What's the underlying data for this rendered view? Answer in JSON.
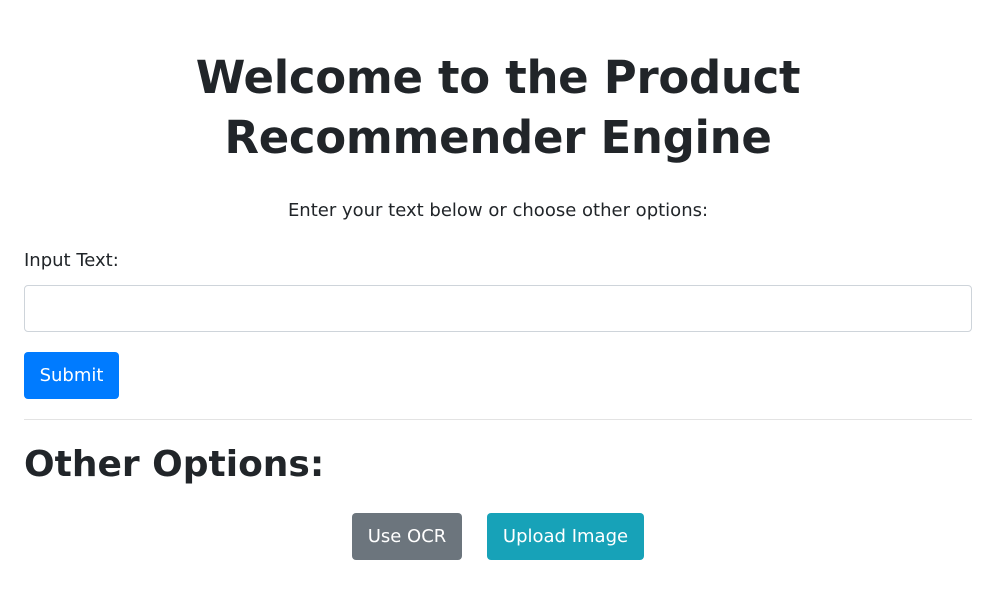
{
  "header": {
    "title": "Welcome to the Product Recommender Engine",
    "subtitle": "Enter your text below or choose other options:"
  },
  "form": {
    "input_label": "Input Text:",
    "input_value": "",
    "input_placeholder": "",
    "submit_label": "Submit"
  },
  "other_options": {
    "heading": "Other Options:",
    "ocr_label": "Use OCR",
    "upload_label": "Upload Image"
  },
  "colors": {
    "primary": "#007bff",
    "secondary": "#6c757d",
    "info": "#17a2b8",
    "text": "#212529"
  }
}
